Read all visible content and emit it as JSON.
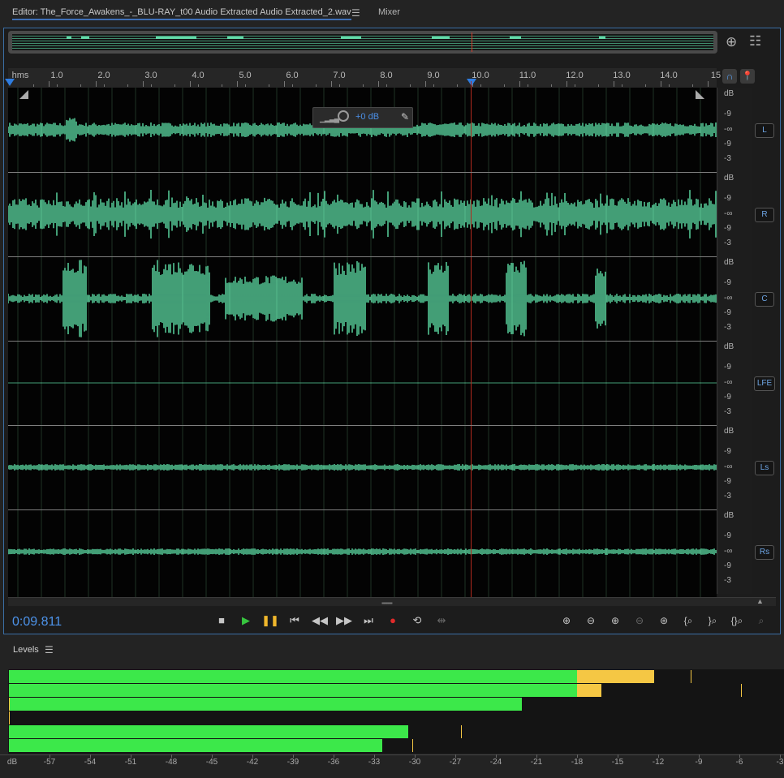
{
  "tabs": {
    "editor_label": "Editor: The_Force_Awakens_-_BLU-RAY_t00 Audio Extracted Audio Extracted_2.wav",
    "mixer_label": "Mixer"
  },
  "ruler": {
    "unit": "hms",
    "labels": [
      "1.0",
      "2.0",
      "3.0",
      "4.0",
      "5.0",
      "6.0",
      "7.0",
      "8.0",
      "9.0",
      "10.0",
      "11.0",
      "12.0",
      "13.0",
      "14.0",
      "15"
    ]
  },
  "hud": {
    "gain_label": "+0 dB"
  },
  "channels": [
    "L",
    "R",
    "C",
    "LFE",
    "Ls",
    "Rs"
  ],
  "db_scale": [
    "dB",
    "-9",
    "-∞",
    "-9",
    "-3"
  ],
  "transport": {
    "current_time": "0:09.811"
  },
  "levels": {
    "title": "Levels",
    "scale": [
      "dB",
      "-57",
      "-54",
      "-51",
      "-48",
      "-45",
      "-42",
      "-39",
      "-36",
      "-33",
      "-30",
      "-27",
      "-24",
      "-21",
      "-18",
      "-15",
      "-12",
      "-9",
      "-6",
      "-3"
    ],
    "meters_db": [
      {
        "level": -12.3,
        "peak": -9.6
      },
      {
        "level": -16.2,
        "peak": -5.9
      },
      {
        "level": -22.1,
        "peak": null
      },
      {
        "level": null,
        "peak": null
      },
      {
        "level": -30.5,
        "peak": -26.6
      },
      {
        "level": -32.4,
        "peak": -30.2
      }
    ]
  },
  "colors": {
    "waveform": "#5fe0a8",
    "meter_green": "#3ce84a",
    "meter_yellow": "#f5c744",
    "playhead": "#b12a1e",
    "accent_blue": "#4d93ea"
  }
}
